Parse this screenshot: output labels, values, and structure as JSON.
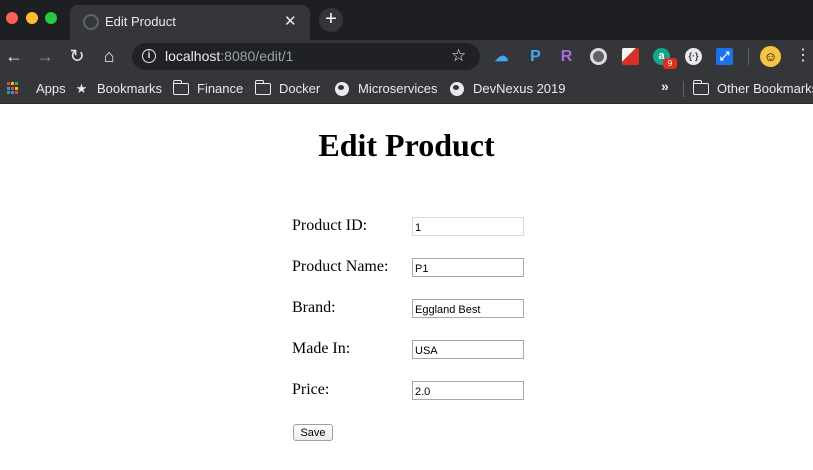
{
  "browser": {
    "tab": {
      "title": "Edit Product",
      "close_glyph": "✕"
    },
    "new_tab_glyph": "+",
    "url": {
      "host": "localhost",
      "rest": ":8080/edit/1"
    },
    "extensions": {
      "p_label": "P",
      "r_label": "R",
      "badge_count": "9",
      "dev_label": "{·}"
    },
    "bookmarks": [
      {
        "label": "Apps",
        "icon": "apps-grid-icon"
      },
      {
        "label": "Bookmarks",
        "icon": "star-icon"
      },
      {
        "label": "Finance",
        "icon": "folder-icon"
      },
      {
        "label": "Docker",
        "icon": "folder-icon"
      },
      {
        "label": "Microservices",
        "icon": "globe-icon"
      },
      {
        "label": "DevNexus 2019",
        "icon": "globe-icon"
      }
    ],
    "other_bookmarks": "Other Bookmarks",
    "overflow_glyph": "»"
  },
  "page": {
    "title": "Edit Product",
    "fields": [
      {
        "label": "Product ID:",
        "value": "1",
        "readonly": true
      },
      {
        "label": "Product Name:",
        "value": "P1"
      },
      {
        "label": "Brand:",
        "value": "Eggland Best"
      },
      {
        "label": "Made In:",
        "value": "USA"
      },
      {
        "label": "Price:",
        "value": "2.0"
      }
    ],
    "save_label": "Save"
  },
  "colors": {
    "tab_strip": "#1e1f22",
    "toolbar": "#35363a",
    "omnibox": "#202124",
    "badge": "#d93025"
  }
}
